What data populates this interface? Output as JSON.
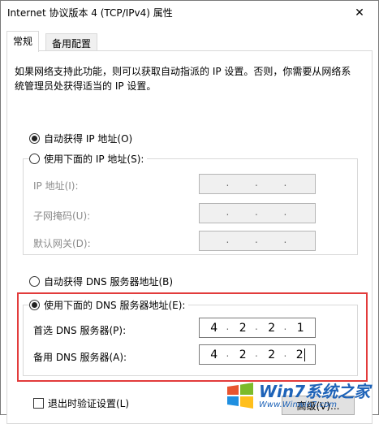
{
  "window": {
    "title": "Internet 协议版本 4 (TCP/IPv4) 属性",
    "close_glyph": "✕"
  },
  "tabs": [
    {
      "label": "常规",
      "active": true
    },
    {
      "label": "备用配置",
      "active": false
    }
  ],
  "description": "如果网络支持此功能，则可以获取自动指派的 IP 设置。否则，你需要从网络系统管理员处获得适当的 IP 设置。",
  "ip_mode": {
    "auto_label": "自动获得 IP 地址(O)",
    "manual_label": "使用下面的 IP 地址(S):",
    "selected": "auto"
  },
  "ip_fields": {
    "ip_address_label": "IP 地址(I):",
    "subnet_label": "子网掩码(U):",
    "gateway_label": "默认网关(D):"
  },
  "dns_mode": {
    "auto_label": "自动获得 DNS 服务器地址(B)",
    "manual_label": "使用下面的 DNS 服务器地址(E):",
    "selected": "manual"
  },
  "dns_fields": {
    "preferred_label": "首选 DNS 服务器(P):",
    "preferred_value": [
      "4",
      "2",
      "2",
      "1"
    ],
    "alternate_label": "备用 DNS 服务器(A):",
    "alternate_value": [
      "4",
      "2",
      "2",
      "2"
    ]
  },
  "validate_on_exit_label": "退出时验证设置(L)",
  "advanced_button_label": "高级(V)...",
  "watermark": {
    "brand": "Win7系统之家",
    "url": "Www.Winwin7.com"
  },
  "colors": {
    "highlight_border": "#e23b3b",
    "watermark": "#1e63b8"
  }
}
